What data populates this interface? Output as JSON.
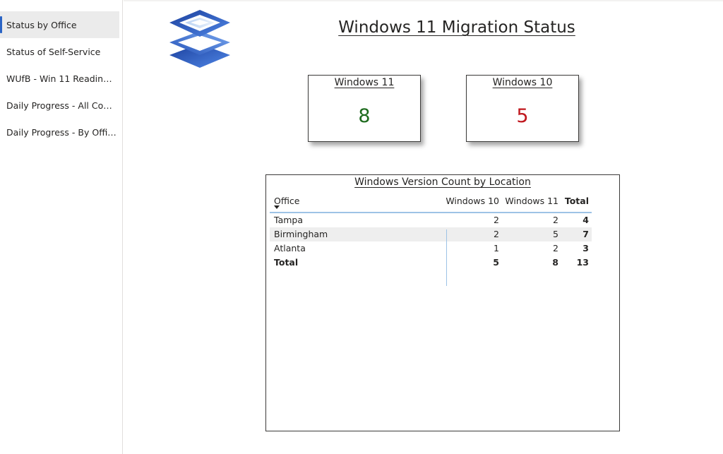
{
  "sidebar": {
    "items": [
      {
        "label": "Status by Office",
        "active": true
      },
      {
        "label": "Status of Self-Service",
        "active": false
      },
      {
        "label": "WUfB - Win 11 Readiness",
        "active": false
      },
      {
        "label": "Daily Progress - All Com...",
        "active": false
      },
      {
        "label": "Daily Progress - By Office",
        "active": false
      }
    ]
  },
  "report": {
    "title": "Windows 11 Migration Status"
  },
  "cards": [
    {
      "title": "Windows 11",
      "value": "8",
      "color": "#1e6b1e"
    },
    {
      "title": "Windows 10",
      "value": "5",
      "color": "#c0171d"
    }
  ],
  "table": {
    "title": "Windows Version Count by Location",
    "headers": {
      "office": "Office",
      "w10": "Windows 10",
      "w11": "Windows 11",
      "total": "Total"
    },
    "rows": [
      {
        "office": "Tampa",
        "w10": "2",
        "w11": "2",
        "total": "4"
      },
      {
        "office": "Birmingham",
        "w10": "2",
        "w11": "5",
        "total": "7"
      },
      {
        "office": "Atlanta",
        "w10": "1",
        "w11": "2",
        "total": "3"
      }
    ],
    "totals": {
      "office": "Total",
      "w10": "5",
      "w11": "8",
      "total": "13"
    }
  },
  "colors": {
    "accent": "#2a64c5",
    "header_rule": "#9dc3e6"
  }
}
